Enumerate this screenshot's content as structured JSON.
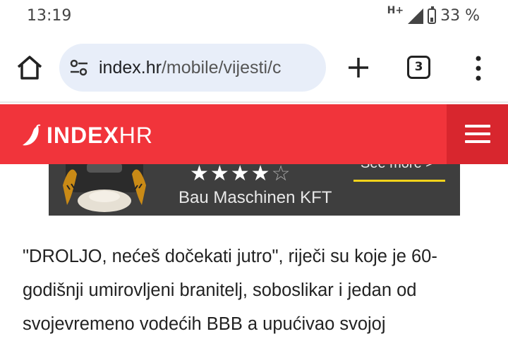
{
  "status_bar": {
    "time": "13:19",
    "network": "H+",
    "battery": "33 %"
  },
  "browser": {
    "url_domain": "index.hr",
    "url_path": "/mobile/vijesti/c",
    "tab_count": "3"
  },
  "site": {
    "logo_bold": "INDEX",
    "logo_light": "HR",
    "brand_color": "#f1343b"
  },
  "ad": {
    "rating_filled": "★★★★",
    "rating_empty": "☆",
    "company": "Bau Maschinen KFT",
    "cta": "See more >"
  },
  "article": {
    "body": "\"DROLJO, nećeš dočekati jutro\", riječi su koje je 60-godišnji umirovljeni branitelj, soboslikar i jedan od svojevremeno vodećih BBB a upućivao svojoj"
  }
}
